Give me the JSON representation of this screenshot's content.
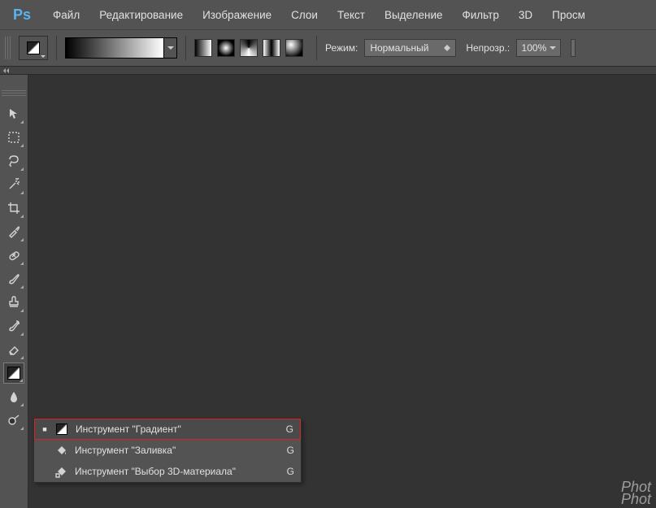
{
  "logo": "Ps",
  "menu": [
    "Файл",
    "Редактирование",
    "Изображение",
    "Слои",
    "Текст",
    "Выделение",
    "Фильтр",
    "3D",
    "Просм"
  ],
  "options": {
    "mode_label": "Режим:",
    "mode_value": "Нормальный",
    "opacity_label": "Непрозр.:",
    "opacity_value": "100%"
  },
  "tools": [
    {
      "name": "move-tool",
      "svg": "arrow"
    },
    {
      "name": "marquee-tool",
      "svg": "marquee"
    },
    {
      "name": "lasso-tool",
      "svg": "lasso"
    },
    {
      "name": "magic-wand-tool",
      "svg": "wand"
    },
    {
      "name": "crop-tool",
      "svg": "crop"
    },
    {
      "name": "eyedropper-tool",
      "svg": "eyedrop"
    },
    {
      "name": "healing-brush-tool",
      "svg": "bandaid"
    },
    {
      "name": "brush-tool",
      "svg": "brush"
    },
    {
      "name": "stamp-tool",
      "svg": "stamp"
    },
    {
      "name": "history-brush-tool",
      "svg": "histbrush"
    },
    {
      "name": "eraser-tool",
      "svg": "eraser"
    },
    {
      "name": "gradient-tool",
      "svg": "gradient",
      "selected": true
    },
    {
      "name": "blur-tool",
      "svg": "drop"
    },
    {
      "name": "dodge-tool",
      "svg": "dodge"
    }
  ],
  "flyout": {
    "items": [
      {
        "label": "Инструмент \"Градиент\"",
        "key": "G",
        "icon": "gradient",
        "selected": true
      },
      {
        "label": "Инструмент \"Заливка\"",
        "key": "G",
        "icon": "bucket"
      },
      {
        "label": "Инструмент \"Выбор 3D-материала\"",
        "key": "G",
        "icon": "bucket3d"
      }
    ]
  },
  "watermark": {
    "l1": "Phot",
    "l2": "Phot"
  }
}
